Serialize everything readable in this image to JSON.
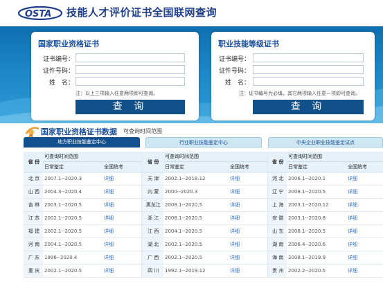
{
  "header": {
    "logo_text": "OSTA",
    "site_title": "技能人才评价证书全国联网查询"
  },
  "left_panel": {
    "title": "国家职业资格证书",
    "fields": [
      {
        "label": "证书编号：",
        "value": ""
      },
      {
        "label": "证件号码：",
        "value": ""
      },
      {
        "label": "姓　名：",
        "value": ""
      }
    ],
    "note": "注：以上三项输入任意两项即可查询。",
    "button": "查 询"
  },
  "right_panel": {
    "title": "职业技能等级证书",
    "fields": [
      {
        "label": "证书编号：",
        "value": ""
      },
      {
        "label": "证件号码：",
        "value": ""
      },
      {
        "label": "姓　名：",
        "value": ""
      }
    ],
    "note": "注：证书编号为必填，其它两项输入任意一项即可查询。",
    "button": "查 询"
  },
  "data_section": {
    "title": "国家职业资格证书数据",
    "subtitle": "可查询时间范围",
    "tabs": [
      "地方职业技能鉴定中心",
      "行业职业技能鉴定中心",
      "中央企业职业技能鉴定试点"
    ],
    "active_tab": 0
  },
  "table": {
    "col_province": "省 份",
    "col_range": "可查询时间范围",
    "col_daily": "日常鉴定",
    "col_exam": "全国统考",
    "rows": [
      [
        [
          "北 京",
          "2007.1--2020.3",
          "详细"
        ],
        [
          "天 津",
          "2002.1--2018.12",
          "详细"
        ],
        [
          "河 北",
          "2006.1--2020.1",
          "详细"
        ]
      ],
      [
        [
          "山 西",
          "2004.3--2020.4",
          "详细"
        ],
        [
          "内 蒙",
          "2000--2020.3",
          "详细"
        ],
        [
          "辽 宁",
          "2008.1--2020.5",
          "详细"
        ]
      ],
      [
        [
          "吉 林",
          "2003.1--2020.5",
          "详细"
        ],
        [
          "黑龙江",
          "2008.1--2020.5",
          "详细"
        ],
        [
          "上 海",
          "2003.1--2020.12",
          "详细"
        ]
      ],
      [
        [
          "江 苏",
          "2002.1--2020.5",
          "详细"
        ],
        [
          "浙 江",
          "2008.1--2020.5",
          "详细"
        ],
        [
          "安 徽",
          "2003.1--2020.8",
          "详细"
        ]
      ],
      [
        [
          "福 建",
          "2002.1--2020.5",
          "详细"
        ],
        [
          "江 西",
          "2004.1--2020.5",
          "详细"
        ],
        [
          "山 东",
          "2008.1--2020.5",
          "详细"
        ]
      ],
      [
        [
          "河 南",
          "2004.1--2020.5",
          "详细"
        ],
        [
          "湖 北",
          "2002.1--2020.5",
          "详细"
        ],
        [
          "湖 南",
          "2006.4--2020.6",
          "详细"
        ]
      ],
      [
        [
          "广 东",
          "1996--2020.4",
          "详细"
        ],
        [
          "广 西",
          "2002.1--2020.5",
          "详细"
        ],
        [
          "海 南",
          "2008.1--2019.9",
          "详细"
        ]
      ],
      [
        [
          "重 庆",
          "2002.1--2020.5",
          "详细"
        ],
        [
          "四 川",
          "1992.1--2019.12",
          "详细"
        ],
        [
          "贵 州",
          "2002.2--2020.5",
          "详细"
        ]
      ]
    ]
  },
  "colors": {
    "brand_blue": "#1a4d9a",
    "button_blue": "#12508a",
    "banner_blue": "#1d86c6",
    "link_blue": "#2d6ecb"
  }
}
